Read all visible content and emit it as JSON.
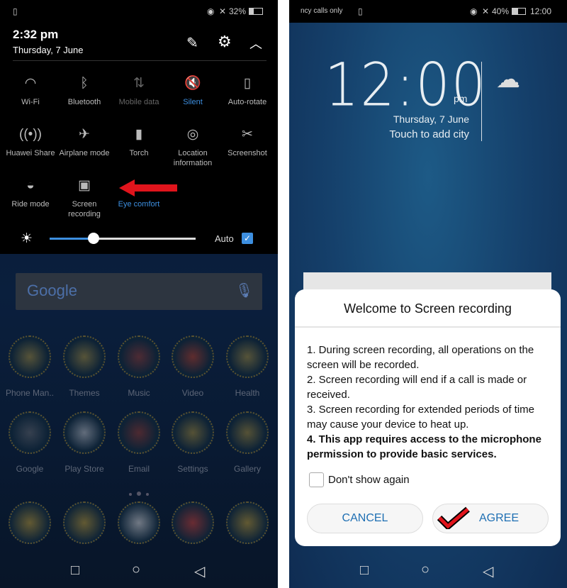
{
  "left": {
    "status": {
      "battery": "32%",
      "icons": [
        "sim-alert-icon",
        "eye-icon",
        "mute-icon",
        "battery-icon"
      ]
    },
    "time": "2:32 pm",
    "date": "Thursday, 7 June",
    "header_icons": [
      "edit-icon",
      "gear-icon",
      "chevron-up-icon"
    ],
    "tiles": [
      {
        "label": "Wi-Fi",
        "icon": "wifi-icon",
        "glyph": "◠",
        "state": "off"
      },
      {
        "label": "Bluetooth",
        "icon": "bluetooth-icon",
        "glyph": "ᛒ",
        "state": "off"
      },
      {
        "label": "Mobile data",
        "icon": "mobile-data-icon",
        "glyph": "⇅",
        "state": "disabled"
      },
      {
        "label": "Silent",
        "icon": "silent-icon",
        "glyph": "🔇",
        "state": "on"
      },
      {
        "label": "Auto-rotate",
        "icon": "auto-rotate-icon",
        "glyph": "▯",
        "state": "off"
      },
      {
        "label": "Huawei Share",
        "icon": "huawei-share-icon",
        "glyph": "((•))",
        "state": "off"
      },
      {
        "label": "Airplane mode",
        "icon": "airplane-icon",
        "glyph": "✈",
        "state": "off"
      },
      {
        "label": "Torch",
        "icon": "torch-icon",
        "glyph": "▮",
        "state": "off"
      },
      {
        "label": "Location information",
        "icon": "location-icon",
        "glyph": "◎",
        "state": "off"
      },
      {
        "label": "Screenshot",
        "icon": "screenshot-icon",
        "glyph": "✂",
        "state": "off"
      },
      {
        "label": "Ride mode",
        "icon": "ride-mode-icon",
        "glyph": "◒",
        "state": "off"
      },
      {
        "label": "Screen recording",
        "icon": "screen-recording-icon",
        "glyph": "▣",
        "state": "off"
      },
      {
        "label": "Eye comfort",
        "icon": "",
        "glyph": "",
        "state": "on"
      }
    ],
    "brightness": {
      "value_percent": 30,
      "auto_label": "Auto",
      "auto_checked": true
    },
    "search": {
      "logo": "Google"
    },
    "apps": [
      {
        "label": "Phone Man..",
        "color": "#c9a63a"
      },
      {
        "label": "Themes",
        "color": "#c9a63a"
      },
      {
        "label": "Music",
        "color": "#b3412e"
      },
      {
        "label": "Video",
        "color": "#e0451f"
      },
      {
        "label": "Health",
        "color": "#c9a63a"
      },
      {
        "label": "Google",
        "color": "#7a7a7a"
      },
      {
        "label": "Play Store",
        "color": "#e8e8e8"
      },
      {
        "label": "Email",
        "color": "#b3412e"
      },
      {
        "label": "Settings",
        "color": "#c9a63a"
      },
      {
        "label": "Gallery",
        "color": "#c9a63a"
      }
    ],
    "dock": [
      {
        "name": "phone",
        "color": "#c9a63a"
      },
      {
        "name": "messages",
        "color": "#c9a63a"
      },
      {
        "name": "app-drawer",
        "color": "#e8e8e8"
      },
      {
        "name": "chrome",
        "color": "#d9443a"
      },
      {
        "name": "camera",
        "color": "#c9a63a"
      }
    ],
    "page_indicator": {
      "pages": 3,
      "current": 2
    }
  },
  "right": {
    "status": {
      "carrier": "ncy calls only",
      "battery": "40%",
      "time": "12:00"
    },
    "clock": {
      "time": "12:00",
      "ampm": "pm",
      "date": "Thursday, 7 June",
      "city": "Touch to add city",
      "weather_icon": "partly-cloudy-icon"
    },
    "dialog": {
      "title": "Welcome to Screen recording",
      "lines": [
        "1. During screen recording, all operations on the screen will be recorded.",
        "2. Screen recording will end if a call is made or received.",
        "3. Screen recording for extended periods of time may cause your device to heat up."
      ],
      "bold_line": "4. This app requires access to the microphone permission to provide basic services.",
      "checkbox_label": "Don't show again",
      "checkbox_checked": false,
      "cancel": "CANCEL",
      "agree": "AGREE"
    }
  },
  "colors": {
    "accent": "#3d8fe0",
    "annotation_red": "#e0141c"
  }
}
